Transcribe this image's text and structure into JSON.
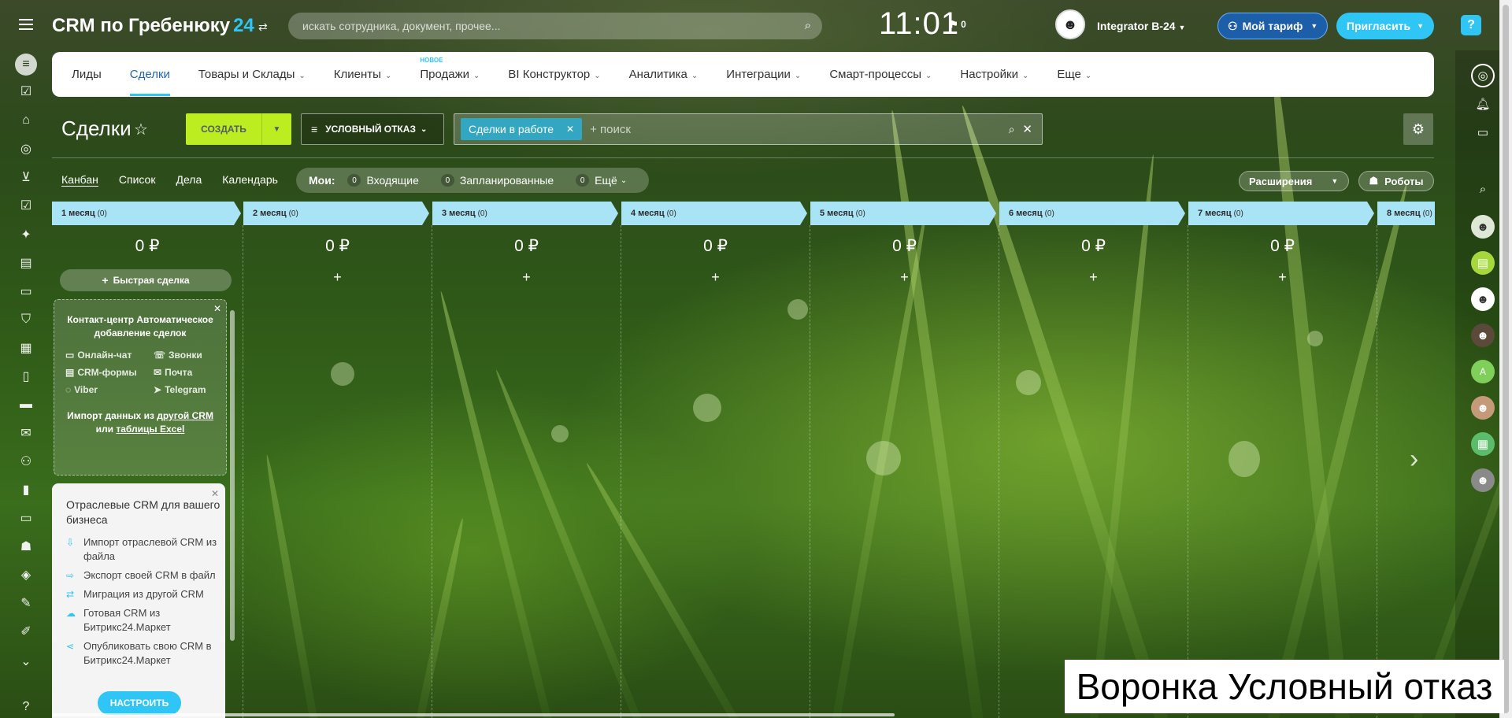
{
  "header": {
    "portal_title": "CRM по Гребенюку",
    "portal_suffix": "24",
    "search_placeholder": "искать сотрудника, документ, прочее...",
    "time": "11:01",
    "flag_count": "0",
    "user_name": "Integrator B-24",
    "tariff_label": "Мой тариф",
    "invite_label": "Пригласить",
    "help_label": "?"
  },
  "nav": {
    "items": [
      {
        "label": "Лиды",
        "chevron": ""
      },
      {
        "label": "Сделки",
        "chevron": ""
      },
      {
        "label": "Товары и Склады",
        "chevron": "⌄"
      },
      {
        "label": "Клиенты",
        "chevron": "⌄"
      },
      {
        "label": "Продажи",
        "chevron": "⌄"
      },
      {
        "label": "BI Конструктор",
        "chevron": "⌄"
      },
      {
        "label": "Аналитика",
        "chevron": "⌄"
      },
      {
        "label": "Интеграции",
        "chevron": "⌄"
      },
      {
        "label": "Смарт-процессы",
        "chevron": "⌄"
      },
      {
        "label": "Настройки",
        "chevron": "⌄"
      },
      {
        "label": "Еще",
        "chevron": "⌄"
      }
    ],
    "new_tag": "новое"
  },
  "toolbar": {
    "page_title": "Сделки",
    "create_label": "СОЗДАТЬ",
    "funnel_label": "УСЛОВНЫЙ ОТКАЗ",
    "filter_tag": "Сделки в работе",
    "search_placeholder": "+ поиск"
  },
  "views": {
    "items": [
      "Канбан",
      "Список",
      "Дела",
      "Календарь"
    ],
    "my_label": "Мои:",
    "counters": [
      {
        "count": "0",
        "label": "Входящие"
      },
      {
        "count": "0",
        "label": "Запланированные"
      },
      {
        "count": "0",
        "label": "Ещё"
      }
    ],
    "extensions_label": "Расширения",
    "robots_label": "Роботы"
  },
  "kanban": {
    "stages": [
      {
        "name": "1 месяц",
        "count": "(0)",
        "sum": "0 ₽"
      },
      {
        "name": "2 месяц",
        "count": "(0)",
        "sum": "0 ₽"
      },
      {
        "name": "3 месяц",
        "count": "(0)",
        "sum": "0 ₽"
      },
      {
        "name": "4 месяц",
        "count": "(0)",
        "sum": "0 ₽"
      },
      {
        "name": "5 месяц",
        "count": "(0)",
        "sum": "0 ₽"
      },
      {
        "name": "6 месяц",
        "count": "(0)",
        "sum": "0 ₽"
      },
      {
        "name": "7 месяц",
        "count": "(0)",
        "sum": "0 ₽"
      },
      {
        "name": "8 месяц",
        "count": "(0)",
        "sum": ""
      }
    ],
    "stage_color": "#a8e4f6",
    "quick_deal_label": "Быстрая сделка",
    "plus_symbol": "+"
  },
  "contact_center": {
    "title": "Контакт-центр Автоматическое добавление сделок",
    "channels": [
      "Онлайн-чат",
      "Звонки",
      "CRM-формы",
      "Почта",
      "Viber",
      "Telegram"
    ],
    "import_prefix": "Импорт данных из",
    "import_link1": "другой CRM",
    "import_or": "или",
    "import_link2": "таблицы Excel"
  },
  "industry_card": {
    "title": "Отраслевые CRM для вашего бизнеса",
    "items": [
      "Импорт отраслевой CRM из файла",
      "Экспорт своей CRM в файл",
      "Миграция из другой CRM",
      "Готовая CRM из Битрикс24.Маркет",
      "Опубликовать свою CRM в Битрикс24.Маркет"
    ],
    "setup_label": "НАСТРОИТЬ"
  },
  "caption": "Воронка Условный отказ",
  "colors": {
    "accent": "#2fc6f6",
    "create": "#bbed21",
    "filter_tag": "#33a6c1"
  }
}
